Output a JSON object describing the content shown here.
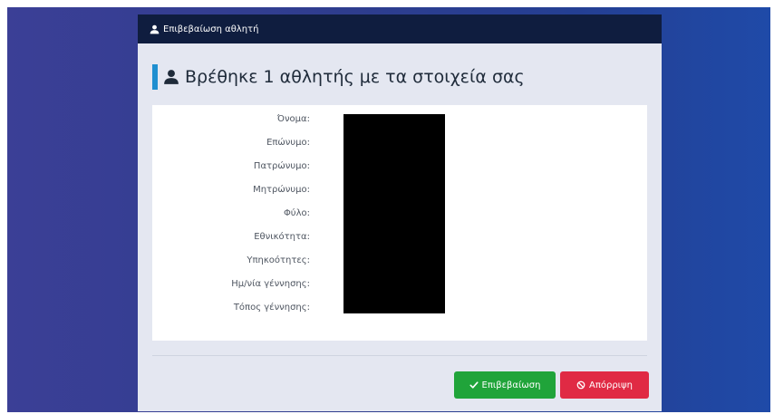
{
  "dialog": {
    "header_title": "Επιβεβαίωση αθλητή",
    "heading": "Βρέθηκε 1 αθλητής με τα στοιχεία σας"
  },
  "fields": [
    {
      "label": "Όνομα:"
    },
    {
      "label": "Επώνυμο:"
    },
    {
      "label": "Πατρώνυμο:"
    },
    {
      "label": "Μητρώνυμο:"
    },
    {
      "label": "Φύλο:"
    },
    {
      "label": "Εθνικότητα:"
    },
    {
      "label": "Υπηκοότητες:"
    },
    {
      "label": "Ημ/νία γέννησης:"
    },
    {
      "label": "Τόπος γέννησης:"
    }
  ],
  "actions": {
    "confirm_label": "Επιβεβαίωση",
    "reject_label": "Απόρριψη"
  },
  "colors": {
    "header_bg": "#0f1d3f",
    "accent": "#1f8fd0",
    "confirm": "#20a43a",
    "reject": "#e02a44"
  },
  "icons": {
    "header": "user-icon",
    "heading": "user-icon",
    "confirm": "check-icon",
    "reject": "ban-icon"
  }
}
